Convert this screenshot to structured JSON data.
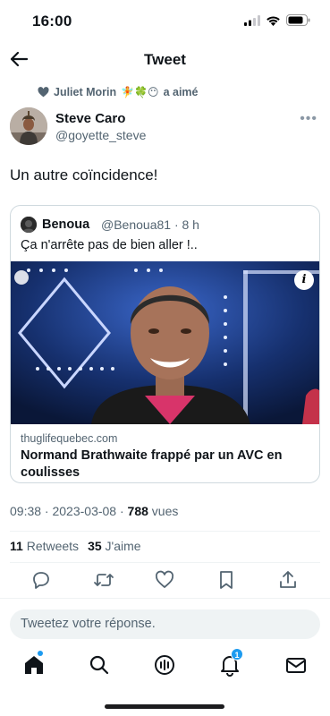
{
  "status_bar": {
    "time": "16:00"
  },
  "header": {
    "title": "Tweet"
  },
  "liked_by": {
    "name": "Juliet Morin",
    "emojis": "🧚🍀😶",
    "suffix": "a aimé"
  },
  "tweet": {
    "author_name": "Steve Caro",
    "author_handle": "@goyette_steve",
    "text": "Un autre coïncidence!",
    "timestamp": "09:38 · 2023-03-08 · ",
    "views_count": "788",
    "views_label": " vues"
  },
  "quote": {
    "name": "Benoua",
    "handle_time": "@Benoua81 · 8 h",
    "text": "Ça n'arrête pas de bien aller !..",
    "domain": "thuglifequebec.com",
    "headline": "Normand Brathwaite frappé par un AVC en coulisses",
    "info": "i"
  },
  "stats": {
    "retweets_count": "11",
    "retweets_label": "Retweets",
    "likes_count": "35",
    "likes_label": "J'aime"
  },
  "reply": {
    "placeholder": "Tweetez votre réponse."
  },
  "nav": {
    "notifications_badge": "1"
  },
  "colors": {
    "accent": "#1d9bf0",
    "muted": "#536471"
  }
}
